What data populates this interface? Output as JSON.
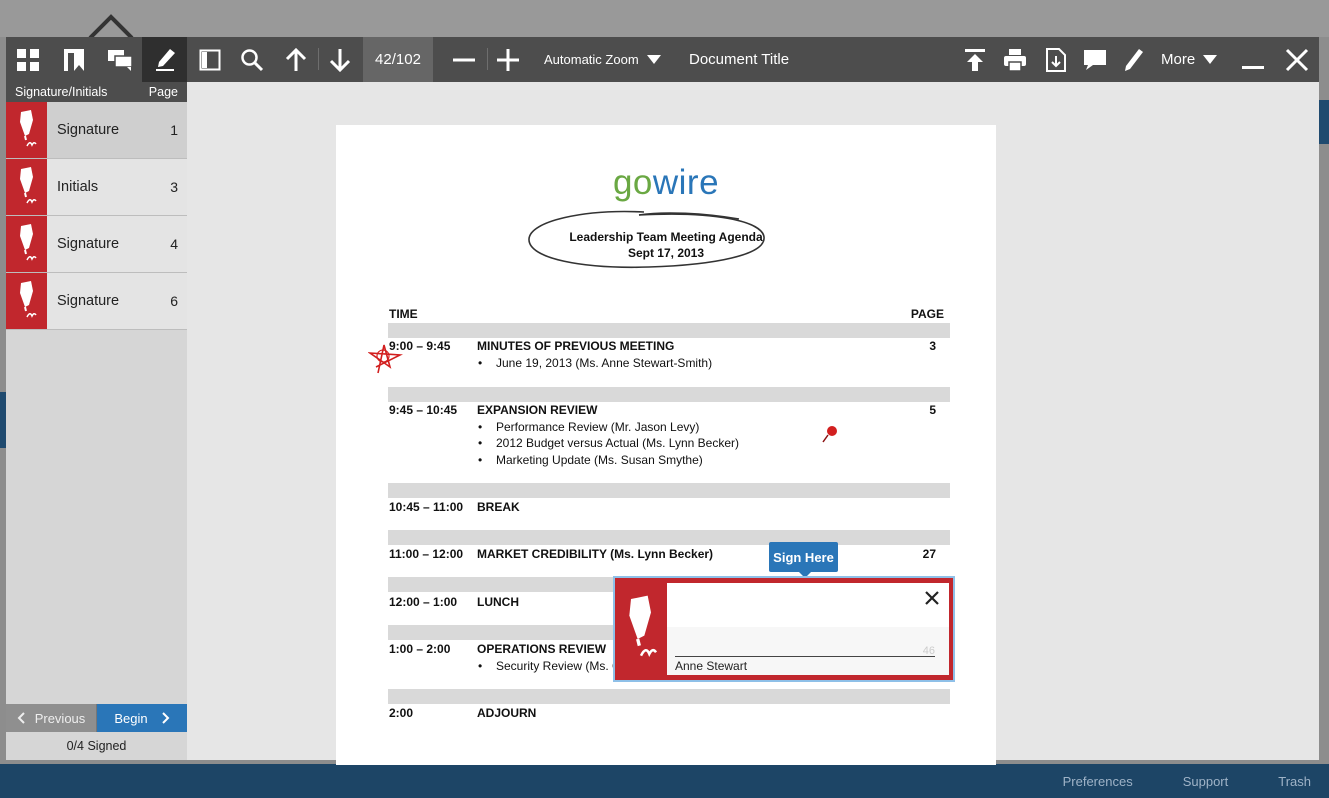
{
  "background": {
    "footer_links": [
      "Preferences",
      "Support",
      "Trash"
    ]
  },
  "toolbar": {
    "page_indicator": "42/102",
    "zoom_label": "Automatic Zoom",
    "document_title": "Document Title",
    "more_label": "More"
  },
  "sidebar": {
    "header_left": "Signature/Initials",
    "header_right": "Page",
    "items": [
      {
        "label": "Signature",
        "page": "1"
      },
      {
        "label": "Initials",
        "page": "3"
      },
      {
        "label": "Signature",
        "page": "4"
      },
      {
        "label": "Signature",
        "page": "6"
      }
    ],
    "previous_label": "Previous",
    "begin_label": "Begin",
    "status": "0/4 Signed"
  },
  "document": {
    "logo_go": "go",
    "logo_wire": "wire",
    "heading_line1": "Leadership Team Meeting Agenda",
    "heading_line2": "Sept 17, 2013",
    "col_time": "TIME",
    "col_page": "PAGE",
    "rows": [
      {
        "time": "9:00 – 9:45",
        "title": "MINUTES OF PREVIOUS MEETING",
        "page": "3",
        "bullets": [
          "June 19, 2013 (Ms. Anne Stewart-Smith)"
        ]
      },
      {
        "time": "9:45 – 10:45",
        "title": "EXPANSION REVIEW",
        "page": "5",
        "bullets": [
          "Performance Review (Mr. Jason Levy)",
          "2012 Budget versus Actual (Ms. Lynn Becker)",
          "Marketing Update (Ms. Susan Smythe)"
        ]
      },
      {
        "time": "10:45 – 11:00",
        "title": "BREAK",
        "page": "",
        "bullets": []
      },
      {
        "time": "11:00 – 12:00",
        "title": "MARKET CREDIBILITY (Ms. Lynn Becker)",
        "page": "27",
        "bullets": []
      },
      {
        "time": "12:00 – 1:00",
        "title": "LUNCH",
        "page": "",
        "bullets": []
      },
      {
        "time": "1:00 – 2:00",
        "title": "OPERATIONS REVIEW",
        "page": "",
        "bullets": [
          "Security Review (Ms. C"
        ]
      },
      {
        "time": "2:00",
        "title": "ADJOURN",
        "page": "",
        "bullets": []
      }
    ]
  },
  "sign_field": {
    "tooltip": "Sign Here",
    "signer_name": "Anne Stewart",
    "hidden_number": "46"
  },
  "colors": {
    "accent_red": "#c1272d",
    "accent_blue": "#2a76b8",
    "toolbar": "#4d4d4d"
  }
}
